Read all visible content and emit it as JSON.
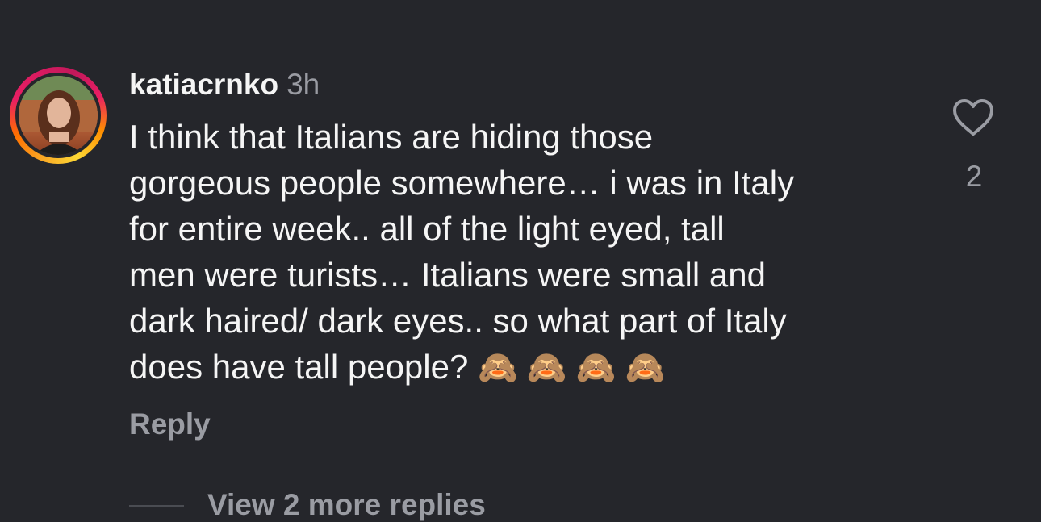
{
  "comment": {
    "username": "katiacrnko",
    "time": "3h",
    "text": "I think that Italians are hiding those\ngorgeous people somewhere… i was in Italy\nfor entire week.. all of the light eyed, tall\nmen were turists… Italians were small and\ndark haired/ dark eyes.. so what part of Italy\ndoes have tall people? ",
    "emojis": "🙈 🙈 🙈 🙈",
    "reply_label": "Reply",
    "like_count": "2",
    "like_icon": "heart-outline-icon"
  },
  "replies": {
    "view_more_label": "View 2 more replies"
  },
  "colors": {
    "background": "#25262b",
    "primary_text": "#f5f5f5",
    "secondary_text": "#9a9ca3",
    "story_ring": [
      "#f9a825",
      "#e91e63"
    ]
  }
}
